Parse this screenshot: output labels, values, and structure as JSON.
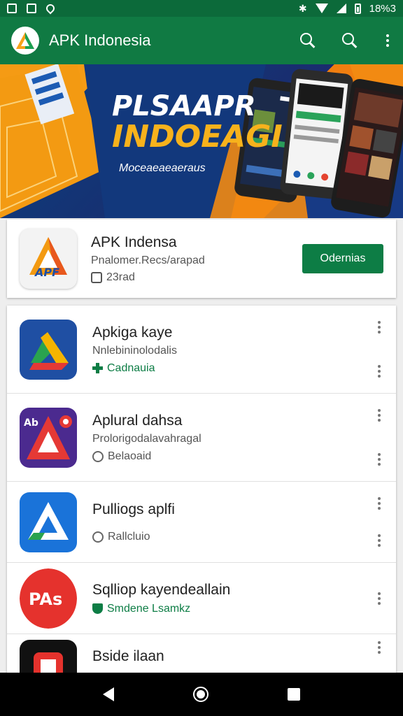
{
  "status_bar": {
    "time": "18%3"
  },
  "app_bar": {
    "title": "APK Indonesia"
  },
  "banner": {
    "line1": "PLSAAPR",
    "line2": "INDOEAGI",
    "tagline": "Moceaeaeaeraus"
  },
  "featured": {
    "name": "APK Indensa",
    "developer": "Pnalomer.Recs/arapad",
    "meta": "23rad",
    "button": "Odernias",
    "icon_text": "APF"
  },
  "list": [
    {
      "name": "Apkiga kaye",
      "developer": "Nnlebininolodalis",
      "meta": "Cadnauia",
      "meta_style": "green",
      "meta_icon": "plus-icon"
    },
    {
      "name": "Aplural dahsa",
      "developer": "Prolorigodalavahragal",
      "meta": "Belaoaid",
      "meta_style": "gray",
      "meta_icon": "clock-icon",
      "icon_text": "Ab"
    },
    {
      "name": "Pulliogs aplfi",
      "developer": "",
      "meta": "Rallcluio",
      "meta_style": "gray",
      "meta_icon": "clock-icon"
    },
    {
      "name": "Sqlliop kayendeallain",
      "developer": "",
      "meta": "Smdene Lsamkz",
      "meta_style": "green",
      "meta_icon": "shield-icon",
      "icon_text": "PAs"
    },
    {
      "name": "Bside ilaan",
      "developer": "",
      "meta": "",
      "meta_style": "gray",
      "meta_icon": ""
    }
  ],
  "colors": {
    "primary": "#107a43",
    "status_bar": "#0c6a3a",
    "install": "#0d7d45"
  }
}
